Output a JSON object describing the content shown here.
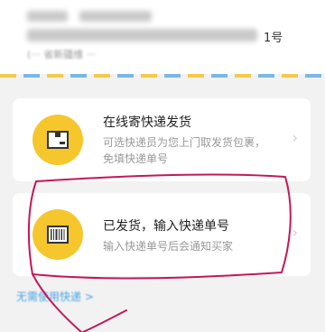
{
  "address": {
    "tail_text": "1号",
    "fragment": "(··· 省新疆维 ···"
  },
  "options": [
    {
      "title": "在线寄快递发货",
      "desc_line1": "可选快递员为您上门取发货包裹，",
      "desc_line2": "免填快递单号",
      "icon": "package-icon"
    },
    {
      "title": "已发货，输入快递单号",
      "desc_line1": "输入快递单号后会通知买家",
      "icon": "barcode-icon"
    }
  ],
  "link_text": "无需使用快递 >",
  "colors": {
    "accent": "#f6c72d",
    "link": "#4aa3e0",
    "annotation": "#c2185b"
  }
}
